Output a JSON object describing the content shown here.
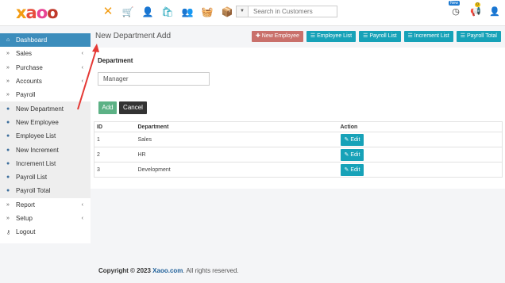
{
  "logo": {
    "x": "x",
    "a": "a",
    "o1": "o",
    "o2": "o"
  },
  "topbar": {
    "icons": [
      "close-icon",
      "cart-plus-icon",
      "user-plus-icon",
      "bag-plus-icon",
      "users-plus-icon",
      "basket-plus-icon",
      "box-plus-icon"
    ],
    "search_placeholder": "Search in Customers",
    "badge_new": "New",
    "badge_count": "0"
  },
  "sidebar": {
    "items": [
      {
        "label": "Dashboard",
        "icon": "home-icon",
        "caret": ""
      },
      {
        "label": "Sales",
        "icon": "chevron-double-icon",
        "caret": "‹"
      },
      {
        "label": "Purchase",
        "icon": "chevron-double-icon",
        "caret": "‹"
      },
      {
        "label": "Accounts",
        "icon": "chevron-double-icon",
        "caret": "‹"
      },
      {
        "label": "Payroll",
        "icon": "chevron-double-icon",
        "caret": "‹"
      },
      {
        "label": "New Department",
        "icon": "circle-arrow-icon",
        "caret": ""
      },
      {
        "label": "New Employee",
        "icon": "circle-arrow-icon",
        "caret": ""
      },
      {
        "label": "Employee List",
        "icon": "circle-arrow-icon",
        "caret": ""
      },
      {
        "label": "New Increment",
        "icon": "circle-arrow-icon",
        "caret": ""
      },
      {
        "label": "Increment List",
        "icon": "circle-arrow-icon",
        "caret": ""
      },
      {
        "label": "Payroll List",
        "icon": "circle-arrow-icon",
        "caret": ""
      },
      {
        "label": "Payroll Total",
        "icon": "circle-arrow-icon",
        "caret": ""
      },
      {
        "label": "Report",
        "icon": "chevron-double-icon",
        "caret": "‹"
      },
      {
        "label": "Setup",
        "icon": "chevron-double-icon",
        "caret": "‹"
      },
      {
        "label": "Logout",
        "icon": "key-icon",
        "caret": ""
      }
    ]
  },
  "page": {
    "title": "New Department Add",
    "buttons": [
      "New Employee",
      "Employee List",
      "Payroll List",
      "Increment List",
      "Payroll Total"
    ]
  },
  "form": {
    "label": "Department",
    "value": "Manager",
    "add_label": "Add",
    "cancel_label": "Cancel"
  },
  "table": {
    "headers": [
      "ID",
      "Department",
      "Action"
    ],
    "rows": [
      {
        "id": "1",
        "department": "Sales",
        "action": "Edit"
      },
      {
        "id": "2",
        "department": "HR",
        "action": "Edit"
      },
      {
        "id": "3",
        "department": "Development",
        "action": "Edit"
      }
    ]
  },
  "footer": {
    "prefix": "Copyright © 2023",
    "brand": "Xaoo.com",
    "suffix": ". All rights reserved."
  },
  "colors": {
    "accent": "#3c8dbc",
    "info": "#17a2b8",
    "danger": "#c9706b",
    "success": "#5cb185",
    "annotation": "#e53935"
  }
}
